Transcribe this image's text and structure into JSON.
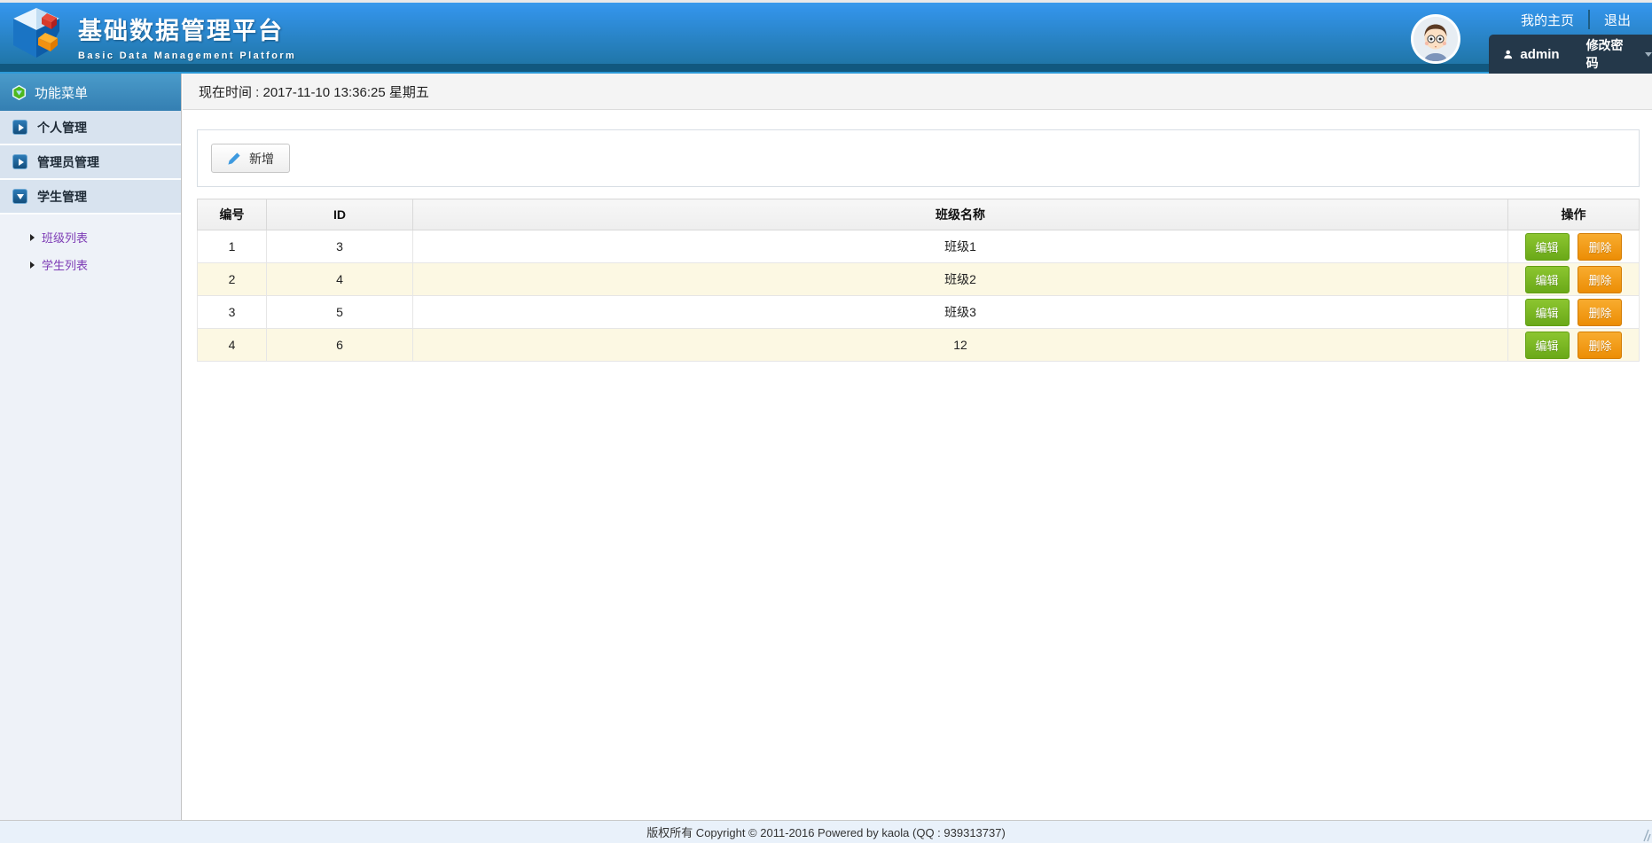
{
  "header": {
    "title": "基础数据管理平台",
    "subtitle": "Basic Data Management Platform",
    "nav_home": "我的主页",
    "nav_logout": "退出",
    "username": "admin",
    "change_password": "修改密码"
  },
  "sidebar": {
    "menu_title": "功能菜单",
    "items": [
      {
        "label": "个人管理"
      },
      {
        "label": "管理员管理"
      },
      {
        "label": "学生管理",
        "children": [
          "班级列表",
          "学生列表"
        ]
      }
    ]
  },
  "main": {
    "current_time": "现在时间 : 2017-11-10 13:36:25 星期五",
    "toolbar": {
      "add_label": "新增"
    },
    "table": {
      "headers": [
        "编号",
        "ID",
        "班级名称",
        "操作"
      ],
      "rows": [
        {
          "no": "1",
          "id": "3",
          "name": "班级1"
        },
        {
          "no": "2",
          "id": "4",
          "name": "班级2"
        },
        {
          "no": "3",
          "id": "5",
          "name": "班级3"
        },
        {
          "no": "4",
          "id": "6",
          "name": "12"
        }
      ],
      "actions": {
        "edit": "编辑",
        "delete": "删除"
      }
    }
  },
  "footer": {
    "copyright": "版权所有 Copyright © 2011-2016 Powered by kaola (QQ : 939313737)"
  },
  "colors": {
    "header_gradient_top": "#3292e6",
    "header_gradient_bottom": "#2076a8",
    "header_dark_band": "#11587f",
    "header_accent_line": "#2d9ad8",
    "menu_header_blue": "#3e8ec2",
    "menu_item_bg": "#d8e3ef",
    "sidebar_bg": "#eef2f8",
    "user_bar_bg": "#24384a",
    "sublink_purple": "#7d3cb5",
    "row_stripe": "#fcf8e3",
    "edit_green": "#76b226",
    "delete_orange": "#f0940f",
    "footer_bg": "#e9f1fa"
  }
}
